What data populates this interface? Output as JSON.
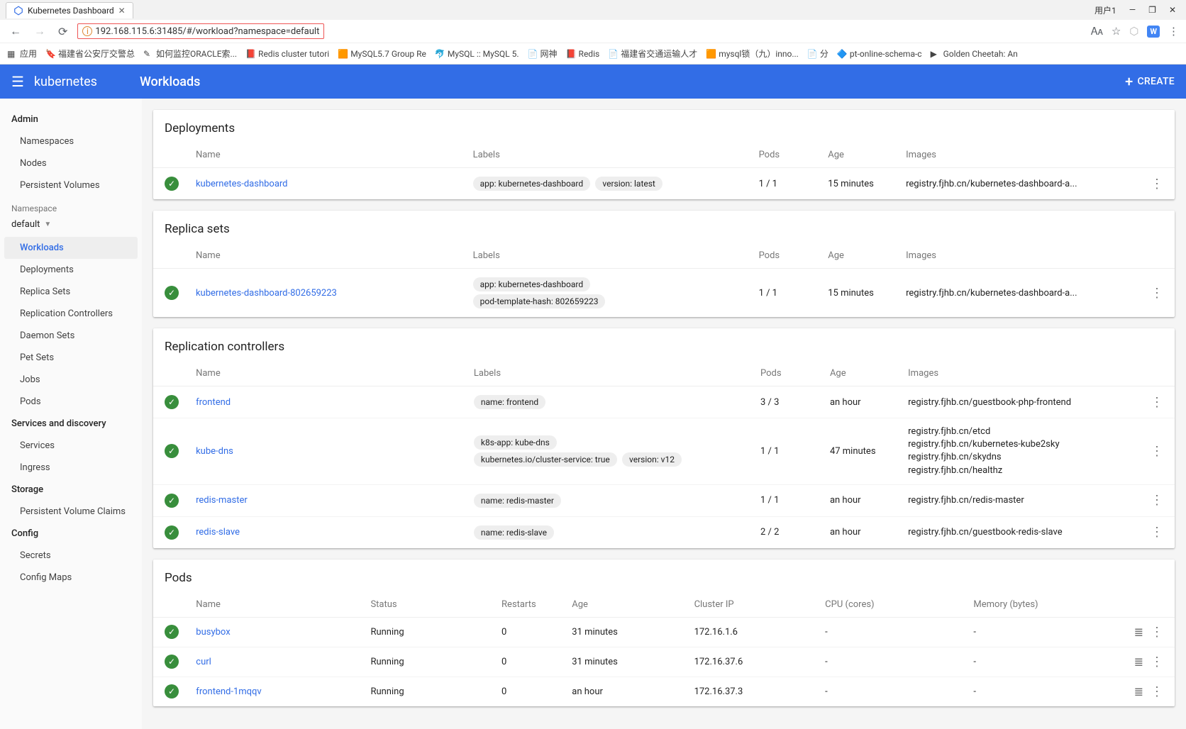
{
  "browser": {
    "tab_title": "Kubernetes Dashboard",
    "user_label": "用户1",
    "url": "192.168.115.6:31485/#/workload?namespace=default",
    "apps_label": "应用",
    "bookmarks": [
      "福建省公安厅交警总",
      "如何监控ORACLE索...",
      "Redis cluster tutori",
      "MySQL5.7 Group Re",
      "MySQL :: MySQL 5.",
      "网神",
      "Redis",
      "福建省交通运输人才",
      "mysql锁（九）inno...",
      "分",
      "pt-online-schema-c",
      "Golden Cheetah: An"
    ]
  },
  "header": {
    "logo": "kubernetes",
    "page_title": "Workloads",
    "create_label": "CREATE"
  },
  "sidebar": {
    "sections": {
      "admin": "Admin",
      "namespace_label": "Namespace",
      "namespace_value": "default",
      "services_discovery": "Services and discovery",
      "storage": "Storage",
      "config": "Config"
    },
    "admin_items": [
      "Namespaces",
      "Nodes",
      "Persistent Volumes"
    ],
    "workloads": "Workloads",
    "workload_items": [
      "Deployments",
      "Replica Sets",
      "Replication Controllers",
      "Daemon Sets",
      "Pet Sets",
      "Jobs",
      "Pods"
    ],
    "services_items": [
      "Services",
      "Ingress"
    ],
    "storage_items": [
      "Persistent Volume Claims"
    ],
    "config_items": [
      "Secrets",
      "Config Maps"
    ]
  },
  "cards": {
    "deployments": {
      "title": "Deployments",
      "cols": {
        "name": "Name",
        "labels": "Labels",
        "pods": "Pods",
        "age": "Age",
        "images": "Images"
      },
      "rows": [
        {
          "name": "kubernetes-dashboard",
          "labels": [
            "app: kubernetes-dashboard",
            "version: latest"
          ],
          "pods": "1 / 1",
          "age": "15 minutes",
          "images": [
            "registry.fjhb.cn/kubernetes-dashboard-a..."
          ]
        }
      ]
    },
    "replicasets": {
      "title": "Replica sets",
      "cols": {
        "name": "Name",
        "labels": "Labels",
        "pods": "Pods",
        "age": "Age",
        "images": "Images"
      },
      "rows": [
        {
          "name": "kubernetes-dashboard-802659223",
          "labels": [
            "app: kubernetes-dashboard",
            "pod-template-hash: 802659223"
          ],
          "pods": "1 / 1",
          "age": "15 minutes",
          "images": [
            "registry.fjhb.cn/kubernetes-dashboard-a..."
          ]
        }
      ]
    },
    "rcs": {
      "title": "Replication controllers",
      "cols": {
        "name": "Name",
        "labels": "Labels",
        "pods": "Pods",
        "age": "Age",
        "images": "Images"
      },
      "rows": [
        {
          "name": "frontend",
          "labels": [
            "name: frontend"
          ],
          "pods": "3 / 3",
          "age": "an hour",
          "images": [
            "registry.fjhb.cn/guestbook-php-frontend"
          ]
        },
        {
          "name": "kube-dns",
          "labels": [
            "k8s-app: kube-dns",
            "kubernetes.io/cluster-service: true",
            "version: v12"
          ],
          "pods": "1 / 1",
          "age": "47 minutes",
          "images": [
            "registry.fjhb.cn/etcd",
            "registry.fjhb.cn/kubernetes-kube2sky",
            "registry.fjhb.cn/skydns",
            "registry.fjhb.cn/healthz"
          ]
        },
        {
          "name": "redis-master",
          "labels": [
            "name: redis-master"
          ],
          "pods": "1 / 1",
          "age": "an hour",
          "images": [
            "registry.fjhb.cn/redis-master"
          ]
        },
        {
          "name": "redis-slave",
          "labels": [
            "name: redis-slave"
          ],
          "pods": "2 / 2",
          "age": "an hour",
          "images": [
            "registry.fjhb.cn/guestbook-redis-slave"
          ]
        }
      ]
    },
    "pods": {
      "title": "Pods",
      "cols": {
        "name": "Name",
        "status": "Status",
        "restarts": "Restarts",
        "age": "Age",
        "ip": "Cluster IP",
        "cpu": "CPU (cores)",
        "mem": "Memory (bytes)"
      },
      "rows": [
        {
          "name": "busybox",
          "status": "Running",
          "restarts": "0",
          "age": "31 minutes",
          "ip": "172.16.1.6",
          "cpu": "-",
          "mem": "-"
        },
        {
          "name": "curl",
          "status": "Running",
          "restarts": "0",
          "age": "31 minutes",
          "ip": "172.16.37.6",
          "cpu": "-",
          "mem": "-"
        },
        {
          "name": "frontend-1mqqv",
          "status": "Running",
          "restarts": "0",
          "age": "an hour",
          "ip": "172.16.37.3",
          "cpu": "-",
          "mem": "-"
        }
      ]
    }
  }
}
